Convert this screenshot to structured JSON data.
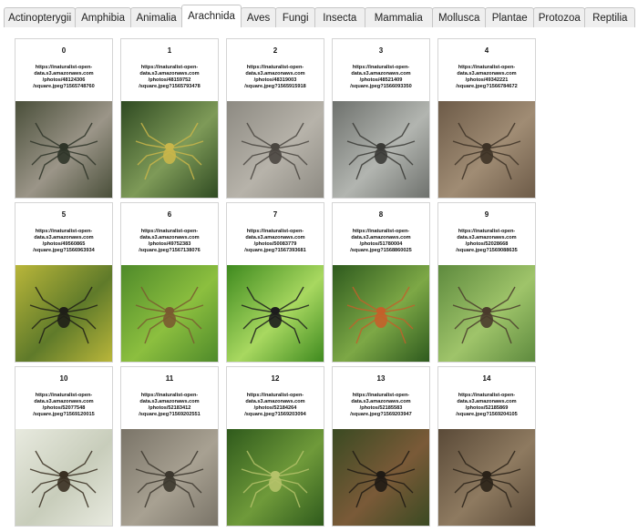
{
  "tabs": [
    {
      "label": "Actinopterygii",
      "active": false
    },
    {
      "label": "Amphibia",
      "active": false
    },
    {
      "label": "Animalia",
      "active": false
    },
    {
      "label": "Arachnida",
      "active": true
    },
    {
      "label": "Aves",
      "active": false
    },
    {
      "label": "Fungi",
      "active": false
    },
    {
      "label": "Insecta",
      "active": false
    },
    {
      "label": "Mammalia",
      "active": false
    },
    {
      "label": "Mollusca",
      "active": false
    },
    {
      "label": "Plantae",
      "active": false
    },
    {
      "label": "Protozoa",
      "active": false
    },
    {
      "label": "Reptilia",
      "active": false
    }
  ],
  "cards": [
    {
      "index": "0",
      "url_lines": [
        "https://inaturalist-open-",
        "data.s3.amazonaws.com",
        "/photos/48124306",
        "/square.jpeg?1565748760"
      ],
      "colors": [
        "#4a4f3a",
        "#9b9588",
        "#2e3428"
      ]
    },
    {
      "index": "1",
      "url_lines": [
        "https://inaturalist-open-",
        "data.s3.amazonaws.com",
        "/photos/48159752",
        "/square.jpeg?1565793478"
      ],
      "colors": [
        "#2f4a22",
        "#7e9a58",
        "#c9b64a"
      ]
    },
    {
      "index": "2",
      "url_lines": [
        "https://inaturalist-open-",
        "data.s3.amazonaws.com",
        "/photos/48319003",
        "/square.jpeg?1565915918"
      ],
      "colors": [
        "#8d8a82",
        "#b7b3aa",
        "#4a4640"
      ]
    },
    {
      "index": "3",
      "url_lines": [
        "https://inaturalist-open-",
        "data.s3.amazonaws.com",
        "/photos/48521409",
        "/square.jpeg?1566093350"
      ],
      "colors": [
        "#6e716d",
        "#b2b5b0",
        "#3a3a36"
      ]
    },
    {
      "index": "4",
      "url_lines": [
        "https://inaturalist-open-",
        "data.s3.amazonaws.com",
        "/photos/49342221",
        "/square.jpeg?1566784672"
      ],
      "colors": [
        "#6d5b48",
        "#a08c74",
        "#3d3226"
      ]
    },
    {
      "index": "5",
      "url_lines": [
        "https://inaturalist-open-",
        "data.s3.amazonaws.com",
        "/photos/49560865",
        "/square.jpeg?1566963934"
      ],
      "colors": [
        "#b9b63a",
        "#5f7a2a",
        "#1f1f17"
      ]
    },
    {
      "index": "6",
      "url_lines": [
        "https://inaturalist-open-",
        "data.s3.amazonaws.com",
        "/photos/49752383",
        "/square.jpeg?1567138076"
      ],
      "colors": [
        "#4f8a2a",
        "#8cbf3f",
        "#7a5a30"
      ]
    },
    {
      "index": "7",
      "url_lines": [
        "https://inaturalist-open-",
        "data.s3.amazonaws.com",
        "/photos/50083779",
        "/square.jpeg?1567393681"
      ],
      "colors": [
        "#3f8a1f",
        "#a8d860",
        "#1d1d1d"
      ]
    },
    {
      "index": "8",
      "url_lines": [
        "https://inaturalist-open-",
        "data.s3.amazonaws.com",
        "/photos/51780004",
        "/square.jpeg?1568860025"
      ],
      "colors": [
        "#2e5a1e",
        "#7da846",
        "#c4602a"
      ]
    },
    {
      "index": "9",
      "url_lines": [
        "https://inaturalist-open-",
        "data.s3.amazonaws.com",
        "/photos/52028668",
        "/square.jpeg?1569088635"
      ],
      "colors": [
        "#5e8a3e",
        "#9fc46a",
        "#4a3b2c"
      ]
    },
    {
      "index": "10",
      "url_lines": [
        "https://inaturalist-open-",
        "data.s3.amazonaws.com",
        "/photos/52077548",
        "/square.jpeg?1569120015"
      ],
      "colors": [
        "#e8eadf",
        "#c8cdbb",
        "#3a3022"
      ]
    },
    {
      "index": "11",
      "url_lines": [
        "https://inaturalist-open-",
        "data.s3.amazonaws.com",
        "/photos/52183412",
        "/square.jpeg?1569202551"
      ],
      "colors": [
        "#7a7468",
        "#a8a192",
        "#3c372e"
      ]
    },
    {
      "index": "12",
      "url_lines": [
        "https://inaturalist-open-",
        "data.s3.amazonaws.com",
        "/photos/52184264",
        "/square.jpeg?1569203094"
      ],
      "colors": [
        "#2f5a1c",
        "#6f9a3a",
        "#b5c26a"
      ]
    },
    {
      "index": "13",
      "url_lines": [
        "https://inaturalist-open-",
        "data.s3.amazonaws.com",
        "/photos/52185583",
        "/square.jpeg?1569203947"
      ],
      "colors": [
        "#3a4a22",
        "#7a5a38",
        "#1f1a14"
      ]
    },
    {
      "index": "14",
      "url_lines": [
        "https://inaturalist-open-",
        "data.s3.amazonaws.com",
        "/photos/52185869",
        "/square.jpeg?1569204105"
      ],
      "colors": [
        "#5a4a38",
        "#8e7a60",
        "#2a2218"
      ]
    }
  ]
}
